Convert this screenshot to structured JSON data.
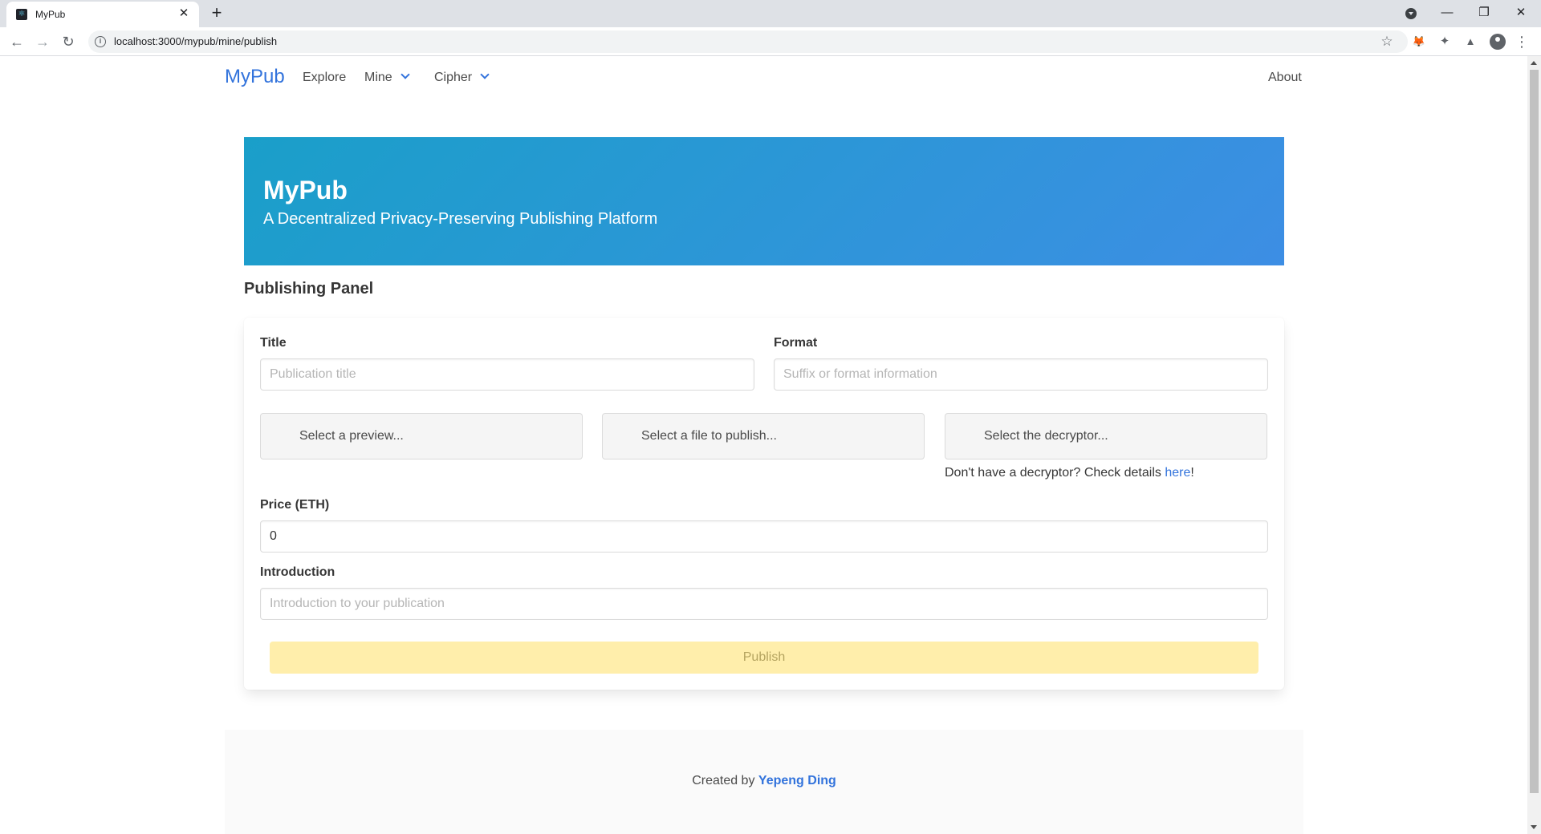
{
  "browser": {
    "tab_title": "MyPub",
    "tab_close": "✕",
    "new_tab": "+",
    "url": "localhost:3000/mypub/mine/publish",
    "controls": {
      "minimize": "—",
      "restore": "❐",
      "close": "✕"
    },
    "nav": {
      "back": "←",
      "forward": "→",
      "reload": "↻"
    },
    "star": "☆",
    "extension_fox": "🦊",
    "extension_puzzle": "✦",
    "extension_flask": "▲",
    "menu": "⋮"
  },
  "site_nav": {
    "brand": "MyPub",
    "items": [
      {
        "label": "Explore"
      },
      {
        "label": "Mine"
      },
      {
        "label": "Cipher"
      }
    ],
    "about": "About"
  },
  "hero": {
    "title": "MyPub",
    "subtitle": "A Decentralized Privacy-Preserving Publishing Platform"
  },
  "panel": {
    "heading": "Publishing Panel",
    "title_label": "Title",
    "title_placeholder": "Publication title",
    "format_label": "Format",
    "format_placeholder": "Suffix or format information",
    "preview_label": "Select a preview...",
    "file_label": "Select a file to publish...",
    "decryptor_label": "Select the decryptor...",
    "help_text": "Don't have a decryptor? Check details ",
    "help_link": "here",
    "help_suffix": "!",
    "price_label": "Price (ETH)",
    "price_value": "0",
    "intro_label": "Introduction",
    "intro_placeholder": "Introduction to your publication",
    "publish_button": "Publish"
  },
  "footer": {
    "prefix": "Created by ",
    "author": "Yepeng Ding"
  },
  "colors": {
    "accent": "#3273dc",
    "hero_start": "#1a9fc9",
    "hero_end": "#3d8ee4",
    "publish_button": "#ffeeab"
  }
}
